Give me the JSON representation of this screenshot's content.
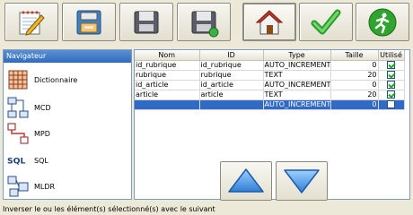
{
  "toolbar": {
    "buttons": [
      {
        "name": "edit",
        "icon": "notepad-pencil-icon"
      },
      {
        "name": "open",
        "icon": "open-folder-icon"
      },
      {
        "name": "save",
        "icon": "floppy-icon"
      },
      {
        "name": "save-as",
        "icon": "floppy-badge-icon"
      },
      {
        "name": "home",
        "icon": "house-icon",
        "pressed": true
      },
      {
        "name": "validate",
        "icon": "checkmark-icon"
      },
      {
        "name": "exit",
        "icon": "running-man-icon"
      }
    ]
  },
  "navigator": {
    "title": "Navigateur",
    "items": [
      {
        "label": "Dictionnaire",
        "icon": "grid-icon"
      },
      {
        "label": "MCD",
        "icon": "mcd-diagram-icon"
      },
      {
        "label": "MPD",
        "icon": "mpd-diagram-icon"
      },
      {
        "label": "SQL",
        "icon": "sql-icon"
      },
      {
        "label": "MLDR",
        "icon": "mldr-diagram-icon"
      }
    ]
  },
  "table": {
    "headers": [
      "Nom",
      "ID",
      "Type",
      "Taille",
      "Utilisé"
    ],
    "rows": [
      {
        "nom": "id_rubrique",
        "id": "id_rubrique",
        "type": "AUTO_INCREMENT",
        "taille": "0",
        "utilise": true
      },
      {
        "nom": "rubrique",
        "id": "rubrique",
        "type": "TEXT",
        "taille": "20",
        "utilise": true
      },
      {
        "nom": "id_article",
        "id": "id_article",
        "type": "AUTO_INCREMENT",
        "taille": "0",
        "utilise": true
      },
      {
        "nom": "article",
        "id": "article",
        "type": "TEXT",
        "taille": "20",
        "utilise": true
      },
      {
        "nom": "",
        "id": "",
        "type": "AUTO_INCREMENT",
        "taille": "0",
        "utilise": false,
        "selected": true
      }
    ]
  },
  "arrows": {
    "up_icon": "arrow-up-icon",
    "down_icon": "arrow-down-icon"
  },
  "status_text": "Inverser le ou les élément(s) sélectionné(s) avec le suivant",
  "colors": {
    "background": "#ece9d8",
    "selection": "#316ac5",
    "nav_header": "#2f6cc0",
    "arrow_blue": "#3a8ee0"
  }
}
